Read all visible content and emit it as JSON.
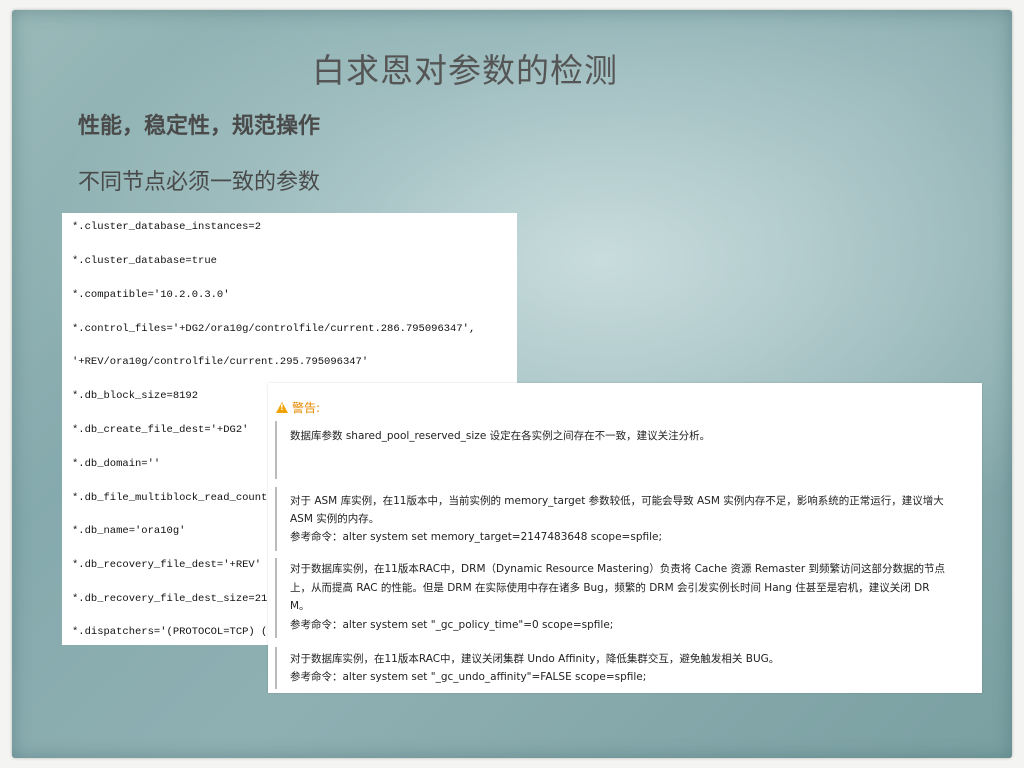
{
  "slide": {
    "title": "白求恩对参数的检测",
    "subtitle": "性能，稳定性，规范操作",
    "subhead": "不同节点必须一致的参数"
  },
  "params": [
    "*.cluster_database_instances=2",
    "*.cluster_database=true",
    "*.compatible='10.2.0.3.0'",
    "*.control_files='+DG2/ora10g/controlfile/current.286.795096347',",
    " '+REV/ora10g/controlfile/current.295.795096347'",
    "*.db_block_size=8192",
    "*.db_create_file_dest='+DG2'",
    "*.db_domain=''",
    "*.db_file_multiblock_read_count",
    "*.db_name='ora10g'",
    "*.db_recovery_file_dest='+REV'",
    "*.db_recovery_file_dest_size=21",
    "*.dispatchers='(PROTOCOL=TCP) ("
  ],
  "warning": {
    "heading": "警告:",
    "lines": [
      "数据库参数 shared_pool_reserved_size 设定在各实例之间存在不一致，建议关注分析。",
      "对于 ASM 库实例，在11版本中，当前实例的 memory_target 参数较低，可能会导致 ASM 实例内存不足，影响系统的正常运行，建议增大",
      "ASM 实例的内存。",
      "参考命令：alter system set memory_target=2147483648 scope=spfile;",
      "对于数据库实例，在11版本RAC中，DRM（Dynamic Resource Mastering）负责将 Cache 资源 Remaster 到频繁访问这部分数据的节点",
      "上，从而提高 RAC 的性能。但是 DRM 在实际使用中存在诸多 Bug，频繁的 DRM 会引发实例长时间 Hang 住甚至是宕机，建议关闭 DR",
      "M。",
      "参考命令：alter system set \"_gc_policy_time\"=0 scope=spfile;",
      "对于数据库实例，在11版本RAC中，建议关闭集群 Undo Affinity，降低集群交互，避免触发相关 BUG。",
      "参考命令：alter system set \"_gc_undo_affinity\"=FALSE scope=spfile;"
    ]
  }
}
